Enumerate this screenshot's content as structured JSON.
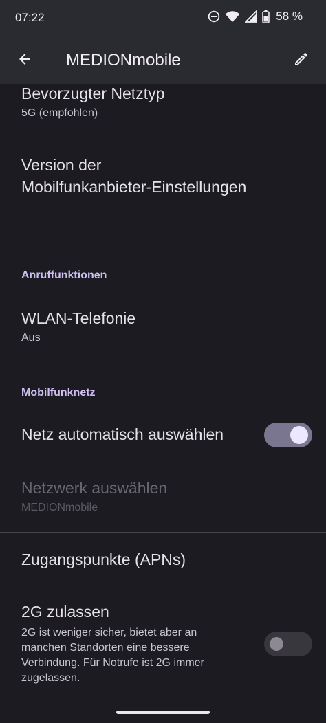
{
  "status_bar": {
    "time": "07:22",
    "battery": "58 %",
    "icons": [
      "do-not-disturb-icon",
      "wifi-icon",
      "cell-signal-icon",
      "battery-icon"
    ]
  },
  "app_bar": {
    "title": "MEDIONmobile",
    "back_icon": "arrow-back-icon",
    "edit_icon": "pencil-icon"
  },
  "settings": {
    "preferred_network": {
      "title": "Bevorzugter Netztyp",
      "summary": "5G (empfohlen)"
    },
    "carrier_version": {
      "title_line1": "Version der",
      "title_line2": "Mobilfunkanbieter-Einstellungen"
    },
    "calling_category": "Anruffunktionen",
    "wifi_calling": {
      "title": "WLAN-Telefonie",
      "summary": "Aus"
    },
    "mobile_network_category": "Mobilfunknetz",
    "auto_select": {
      "title": "Netz automatisch auswählen",
      "enabled": true
    },
    "select_network": {
      "title": "Netzwerk auswählen",
      "summary": "MEDIONmobile"
    },
    "apns": {
      "title": "Zugangspunkte (APNs)"
    },
    "allow_2g": {
      "title": "2G zulassen",
      "summary_lines": [
        "2G ist weniger sicher, bietet aber an",
        "manchen Standorten eine bessere",
        "Verbindung. Für Notrufe ist 2G immer",
        "zugelassen."
      ],
      "enabled": false
    }
  },
  "colors": {
    "background": "#1c1b21",
    "app_bar": "#2a2a31",
    "accent": "#cdc0f0",
    "switch_on_track": "#7a7690",
    "switch_on_thumb": "#ece7ff"
  }
}
